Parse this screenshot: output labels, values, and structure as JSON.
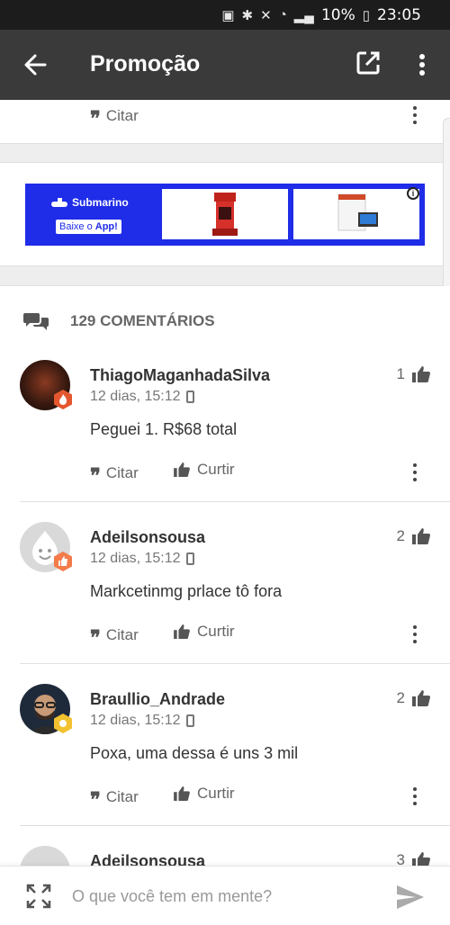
{
  "status_bar": {
    "battery": "10%",
    "time": "23:05"
  },
  "app_bar": {
    "title": "Promoção",
    "back_icon": "arrow-left-icon",
    "open_icon": "open-in-new-icon",
    "menu_icon": "more-vert-icon"
  },
  "prev_comment": {
    "cite_label": "Citar"
  },
  "ad": {
    "brand": "Submarino",
    "cta": "Baixe o ",
    "cta_bold": "App!",
    "info_glyph": "i",
    "brand_color": "#1f2ce8"
  },
  "comments": {
    "count_label": "129 COMENTÁRIOS",
    "items": [
      {
        "name": "ThiagoMaganhadaSilva",
        "time": "12 dias, 15:12",
        "text": "Peguei 1. R$68 total",
        "likes": "1",
        "cite_label": "Citar",
        "like_label": "Curtir",
        "badge_color": "#e4572e"
      },
      {
        "name": "Adeilsonsousa",
        "time": "12 dias, 15:12",
        "text": "Markcetinmg prlace tô fora",
        "likes": "2",
        "cite_label": "Citar",
        "like_label": "Curtir",
        "badge_color": "#f47b4a"
      },
      {
        "name": "Braullio_Andrade",
        "time": "12 dias, 15:12",
        "text": "Poxa, uma dessa é uns 3 mil",
        "likes": "2",
        "cite_label": "Citar",
        "like_label": "Curtir",
        "badge_color": "#f2c230"
      },
      {
        "name": "Adeilsonsousa",
        "likes": "3"
      }
    ]
  },
  "composer": {
    "placeholder": "O que você tem em mente?"
  }
}
